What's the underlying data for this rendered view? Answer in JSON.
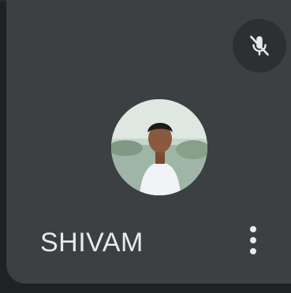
{
  "participant": {
    "name": "SHIVAM",
    "mic_status_icon": "mic-off-icon",
    "avatar_icon": "profile-photo",
    "more_icon": "more-vert-icon"
  },
  "colors": {
    "tile_background": "#3c4043",
    "page_background": "#202124",
    "text": "#e8eaed",
    "badge_background": "#5f6368"
  }
}
